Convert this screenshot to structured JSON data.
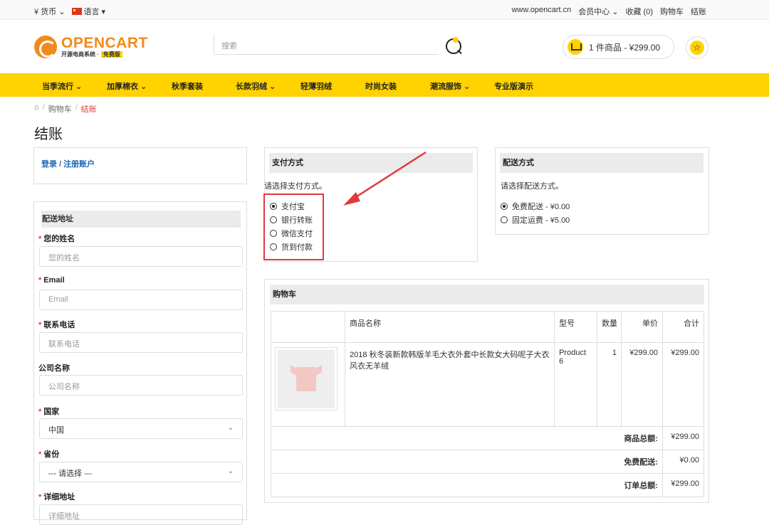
{
  "topbar": {
    "currency": "¥ 货币 ⌄",
    "language": "语言 ▾",
    "site": "www.opencart.cn",
    "account": "会员中心 ⌄",
    "wishlist": "收藏 (0)",
    "cart": "购物车",
    "checkout": "结账"
  },
  "header": {
    "brand": "OPENCART",
    "brand_sub": "开源电商系统 ·",
    "brand_badge": "免费版",
    "search_placeholder": "搜索",
    "cart_summary": "1 件商品 - ¥299.00"
  },
  "nav": [
    "当季流行 ⌄",
    "加厚棉衣 ⌄",
    "秋季套装",
    "长款羽绒 ⌄",
    "轻薄羽绒",
    "时尚女装",
    "潮流服饰 ⌄",
    "专业版演示"
  ],
  "breadcrumb": {
    "cart": "购物车",
    "checkout": "结账"
  },
  "page_title": "结账",
  "login": {
    "link": "登录 / 注册账户"
  },
  "shipping_address": {
    "title": "配送地址",
    "fields": [
      {
        "label": "您的姓名",
        "required": true,
        "placeholder": "您的姓名"
      },
      {
        "label": "Email",
        "required": true,
        "placeholder": "Email"
      },
      {
        "label": "联系电话",
        "required": true,
        "placeholder": "联系电话"
      },
      {
        "label": "公司名称",
        "required": false,
        "placeholder": "公司名称"
      },
      {
        "label": "国家",
        "required": true,
        "value": "中国"
      },
      {
        "label": "省份",
        "required": true,
        "value": "--- 请选择 ---"
      },
      {
        "label": "详细地址",
        "required": true,
        "placeholder": "详细地址"
      }
    ]
  },
  "payment": {
    "title": "支付方式",
    "hint": "请选择支付方式。",
    "options": [
      "支付宝",
      "银行转账",
      "微信支付",
      "货到付款"
    ],
    "selected": 0
  },
  "shipping_method": {
    "title": "配送方式",
    "hint": "请选择配送方式。",
    "options": [
      "免费配送 - ¥0.00",
      "固定运费 - ¥5.00"
    ],
    "selected": 0
  },
  "cart": {
    "title": "购物车",
    "headers": {
      "name": "商品名称",
      "model": "型号",
      "qty": "数量",
      "price": "单价",
      "total": "合计"
    },
    "item": {
      "name": "2018 秋冬装新款韩版羊毛大衣外套中长款女大码呢子大衣风衣无羊绒",
      "model": "Product 6",
      "qty": "1",
      "price": "¥299.00",
      "total": "¥299.00"
    },
    "totals": [
      {
        "label": "商品总额:",
        "value": "¥299.00"
      },
      {
        "label": "免费配送:",
        "value": "¥0.00"
      },
      {
        "label": "订单总额:",
        "value": "¥299.00"
      }
    ]
  },
  "colors": {
    "accent": "#ffd200",
    "brand": "#f28a1b",
    "annotation": "#e4393c"
  }
}
